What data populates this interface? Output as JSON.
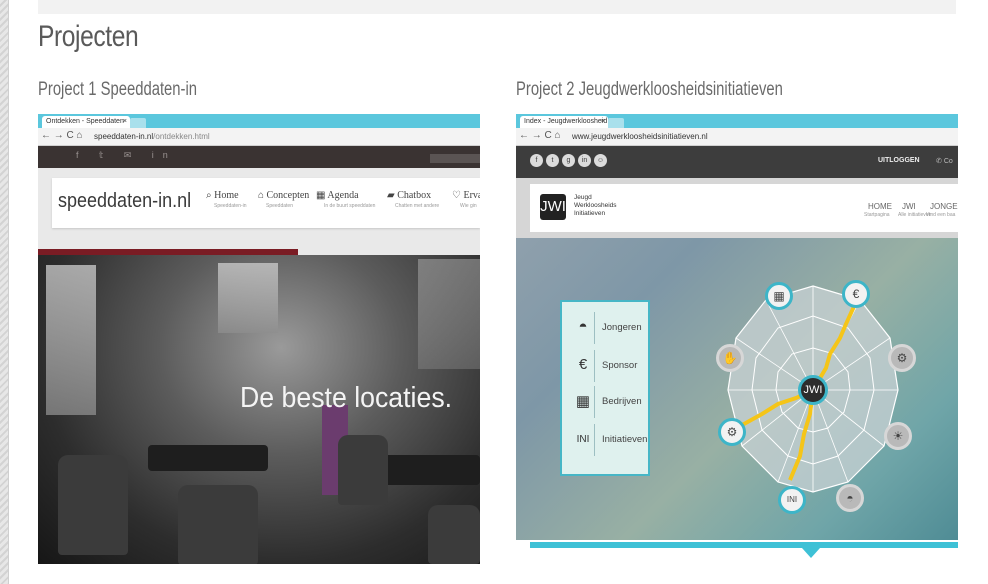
{
  "page": {
    "title": "Projecten"
  },
  "projects": [
    {
      "title": "Project 1 Speeddaten-in",
      "browser": {
        "tab_title": "Ontdekken - Speeddaten",
        "tab_close": "×",
        "url_domain": "speeddaten-in.nl",
        "url_path": "/ontdekken.html"
      },
      "site": {
        "logo": "speeddaten-in.nl",
        "nav": [
          {
            "label": "Home",
            "sub": "Speeddaten-in",
            "icon": "search-icon"
          },
          {
            "label": "Concepten",
            "sub": "Speeddaten",
            "icon": "home-icon"
          },
          {
            "label": "Agenda",
            "sub": "In de buurt speeddaten",
            "icon": "calendar-icon"
          },
          {
            "label": "Chatbox",
            "sub": "Chatten met andere",
            "icon": "chat-icon"
          },
          {
            "label": "Ervar",
            "sub": "Wie gin",
            "icon": "heart-icon"
          }
        ],
        "headline": "De beste locaties."
      }
    },
    {
      "title": "Project 2 Jeugdwerkloosheidsinitiatieven",
      "browser": {
        "tab_title": "Index - Jeugdwerkloosheid",
        "tab_close": "×",
        "url_domain": "www.jeugdwerkloosheidsinitiatieven.nl"
      },
      "site": {
        "logout": "UITLOGGEN",
        "contact": "Co",
        "logo_mark": "JWI",
        "logo_text": [
          "Jeugd",
          "Werkloosheids",
          "Initiatieven"
        ],
        "nav": [
          {
            "label": "HOME",
            "sub": "Startpagina"
          },
          {
            "label": "JWI",
            "sub": "Alle initiatieven"
          },
          {
            "label": "JONGERE",
            "sub": "Vind een baa"
          }
        ],
        "legend": [
          {
            "label": "Jongeren",
            "icon": "graduation-cap-icon"
          },
          {
            "label": "Sponsor",
            "icon": "euro-hand-icon"
          },
          {
            "label": "Bedrijven",
            "icon": "building-icon"
          },
          {
            "label": "Initiatieven",
            "icon": "ini-text-icon",
            "icon_text": "INI"
          }
        ],
        "web_center": "JWI",
        "web_node_ini": "INI"
      }
    }
  ],
  "colors": {
    "accent_cyan": "#3ec1d6",
    "dark_red": "#7a1c24",
    "yellow_line": "#f5c518"
  }
}
